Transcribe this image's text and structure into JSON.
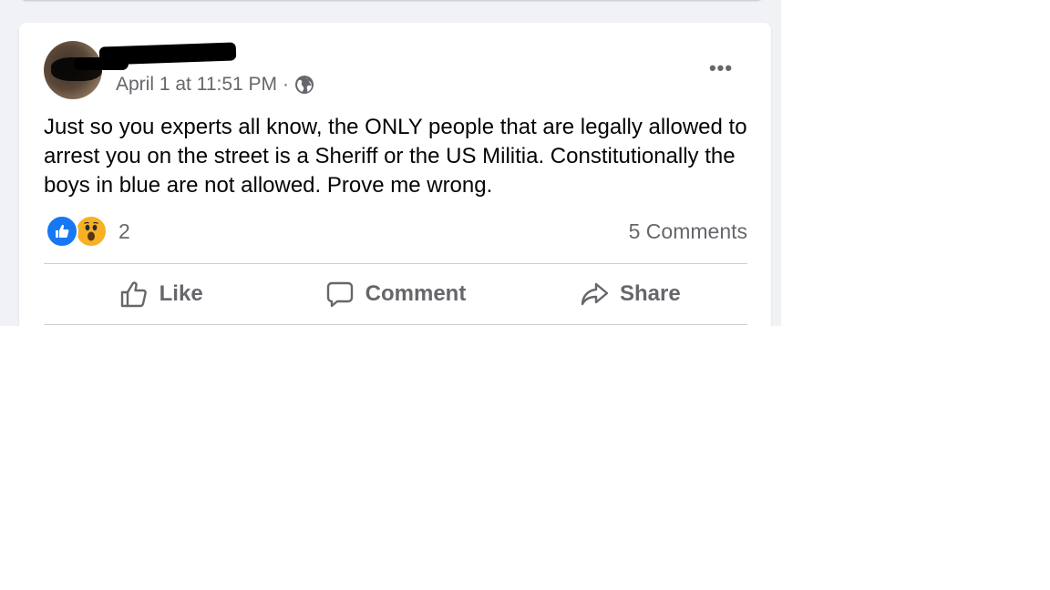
{
  "post": {
    "timestamp": "April 1 at 11:51 PM",
    "separator": "·",
    "audience_icon": "globe-icon",
    "more_icon": "more-options-icon",
    "more_label": "•••",
    "text": "Just so you experts all know, the ONLY people that are legally allowed to arrest you on the street is a Sheriff or the US Militia. Constitutionally the boys in blue are not allowed. Prove me wrong.",
    "reactions": {
      "icons": [
        "like-reaction-icon",
        "wow-reaction-icon"
      ],
      "count": "2"
    },
    "comments_count": "5 Comments"
  },
  "actions": {
    "like": "Like",
    "comment": "Comment",
    "share": "Share"
  },
  "colors": {
    "feed_background": "#f0f2f5",
    "card_background": "#ffffff",
    "secondary_text": "#65676b",
    "primary_text": "#050505",
    "like_blue": "#1877f2",
    "wow_yellow": "#f7b125",
    "divider": "#ced0d4"
  }
}
